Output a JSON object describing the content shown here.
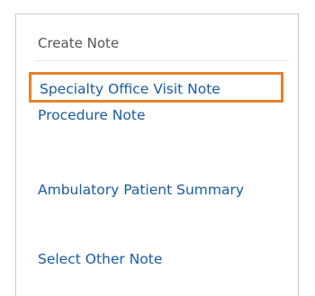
{
  "menu": {
    "header": "Create Note",
    "items": [
      {
        "label": "Specialty Office Visit Note",
        "selected": true
      },
      {
        "label": "Procedure Note",
        "selected": false
      },
      {
        "label": "Ambulatory Patient Summary",
        "selected": false
      },
      {
        "label": "Select Other Note",
        "selected": false
      }
    ]
  },
  "colors": {
    "link": "#1b5a9e",
    "highlight_border": "#e8822a",
    "header_text": "#555555",
    "panel_border": "#c9c9c9"
  }
}
